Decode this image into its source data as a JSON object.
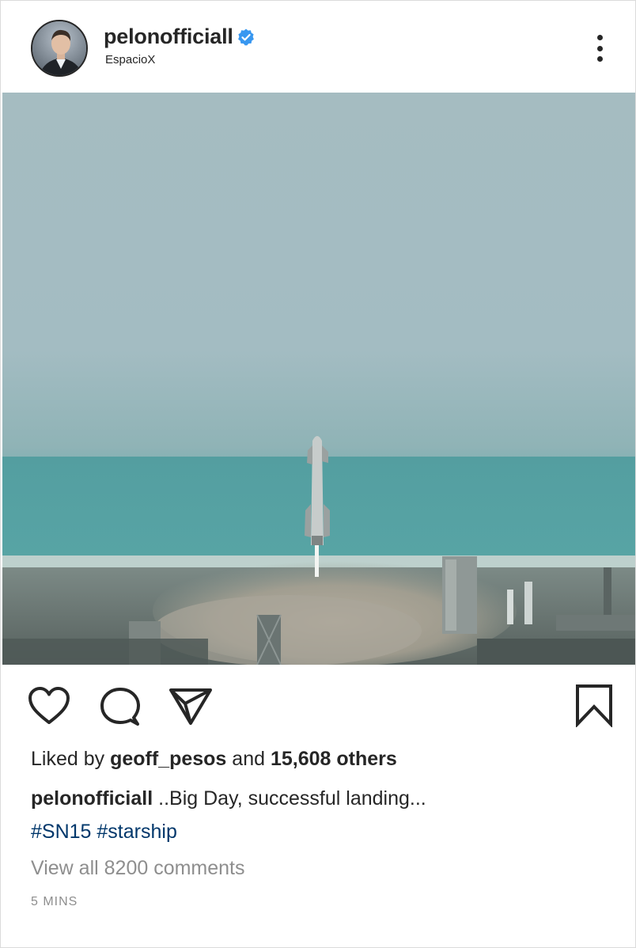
{
  "header": {
    "username": "pelonofficiall",
    "location": "EspacioX",
    "verified_color": "#3897f0"
  },
  "actions": {
    "like_icon": "heart-icon",
    "comment_icon": "comment-icon",
    "share_icon": "paper-plane-icon",
    "save_icon": "bookmark-icon"
  },
  "likes": {
    "prefix": "Liked by",
    "user": "geoff_pesos",
    "joiner": "and",
    "others": "15,608 others"
  },
  "caption": {
    "username": "pelonofficiall",
    "text": "..Big Day, successful landing...",
    "hashtags": [
      "#SN15",
      "#starship"
    ]
  },
  "comments_link": "View all 8200 comments",
  "timestamp": "5 MINS",
  "colors": {
    "text": "#262626",
    "muted": "#8e8e8e",
    "link": "#00376b",
    "border": "#dbdbdb"
  }
}
